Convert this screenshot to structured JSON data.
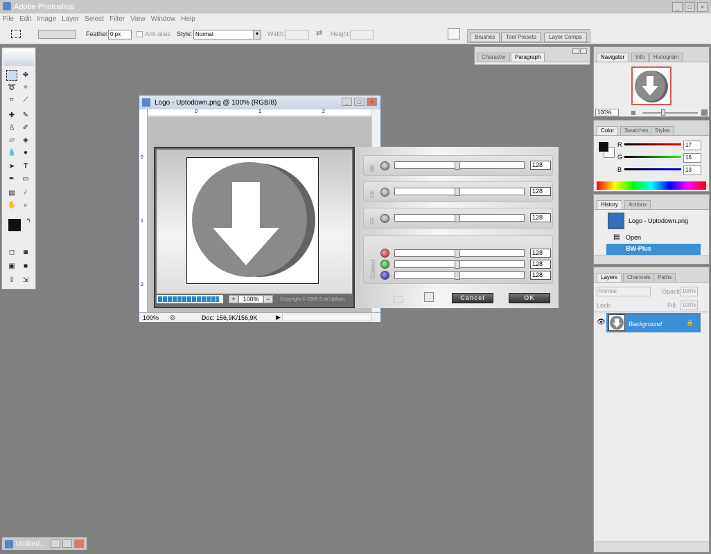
{
  "app": {
    "title": "Adobe Photoshop"
  },
  "menu": [
    "File",
    "Edit",
    "Image",
    "Layer",
    "Select",
    "Filter",
    "View",
    "Window",
    "Help"
  ],
  "options": {
    "feather_label": "Feather:",
    "feather_value": "0 px",
    "antialias_label": "Anti-alias",
    "style_label": "Style:",
    "style_value": "Normal",
    "width_label": "Width:",
    "height_label": "Height:"
  },
  "palette_well": {
    "tabs": [
      "Brushes",
      "Tool Presets",
      "Layer Comps"
    ]
  },
  "char_panel": {
    "tabs": [
      "Character",
      "Paragraph"
    ]
  },
  "navigator": {
    "tabs": [
      "Navigator",
      "Info",
      "Histogram"
    ],
    "zoom": "100%"
  },
  "color_panel": {
    "tabs": [
      "Color",
      "Swatches",
      "Styles"
    ],
    "r_label": "R",
    "g_label": "G",
    "b_label": "B",
    "r": "17",
    "g": "16",
    "b": "13"
  },
  "history": {
    "tabs": [
      "History",
      "Actions"
    ],
    "snapshot": "Logo - Uptodown.png",
    "items": [
      "Open",
      "BW-Plus"
    ]
  },
  "layers": {
    "tabs": [
      "Layers",
      "Channels",
      "Paths"
    ],
    "blend_mode": "Normal",
    "opacity_label": "Opacity:",
    "opacity": "100%",
    "lock_label": "Lock:",
    "fill_label": "Fill:",
    "fill": "100%",
    "layer_name": "Background"
  },
  "document": {
    "title": "Logo - Uptodown.png @ 100% (RGB/8)",
    "zoom": "100%",
    "doc_info": "Doc: 156,9K/156,9K",
    "ruler_h": [
      "0",
      "1",
      "2"
    ],
    "ruler_v": [
      "0",
      "1",
      "2"
    ]
  },
  "plugin": {
    "preview_zoom": "100%",
    "copyright": "Copyright © 2005  S.W.Upham",
    "bf_label": "BF",
    "cf_label": "CF",
    "sf_label": "SF",
    "colour_label": "Colour",
    "bf": "128",
    "cf": "128",
    "sf": "128",
    "red": "128",
    "green": "128",
    "blue": "128",
    "progress": 0.96,
    "cancel": "Cancel",
    "ok": "OK"
  },
  "taskbar": {
    "item": "Untitled..."
  }
}
